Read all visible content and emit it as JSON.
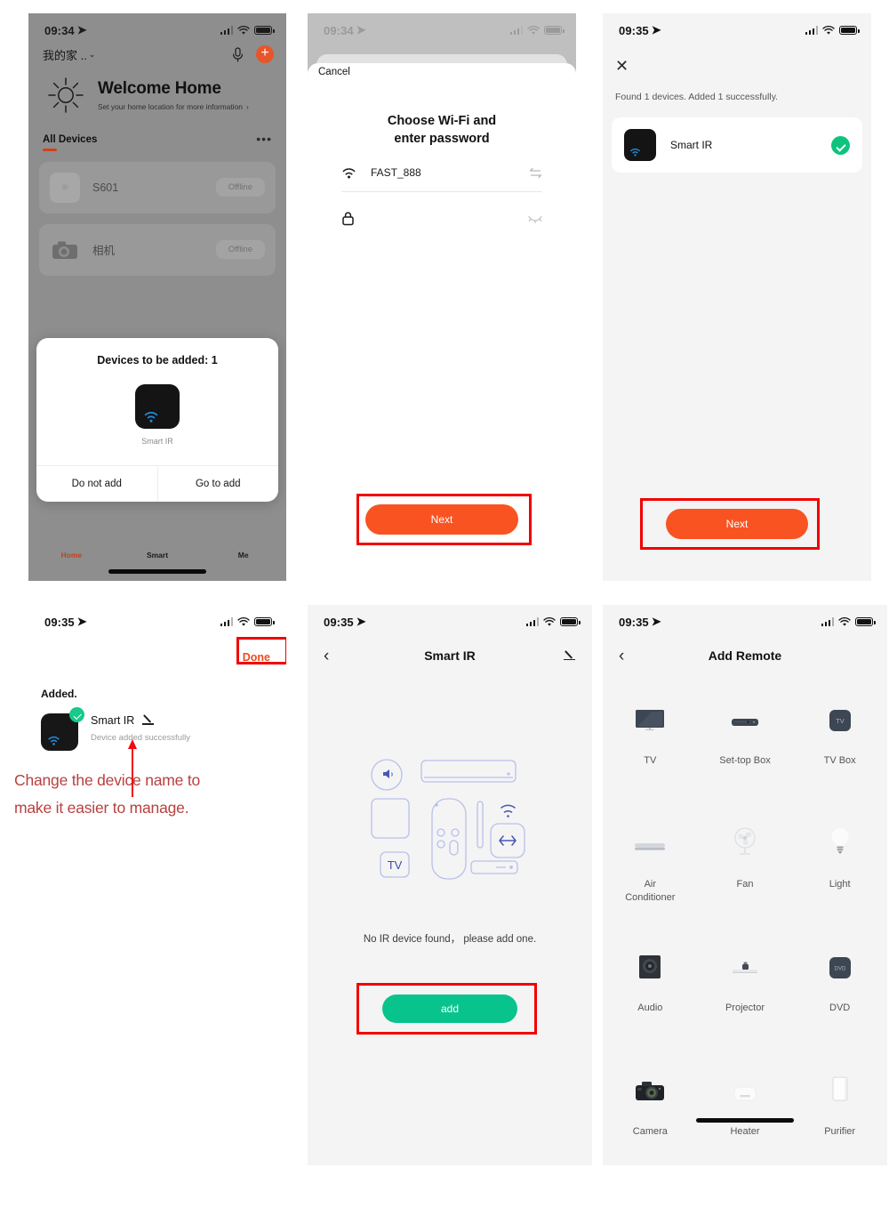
{
  "panel1": {
    "status": {
      "time": "09:34"
    },
    "home_name": "我的家 ..",
    "welcome_title": "Welcome Home",
    "welcome_sub": "Set your home location for more information",
    "section_title": "All Devices",
    "devices": [
      {
        "name": "S601",
        "state": "Offline"
      },
      {
        "name": "相机",
        "state": "Offline"
      }
    ],
    "modal": {
      "title": "Devices to be added: 1",
      "device_name": "Smart IR",
      "cancel_label": "Do not add",
      "confirm_label": "Go to add"
    },
    "tabs": [
      {
        "label": "Home",
        "active": true
      },
      {
        "label": "Smart",
        "active": false
      },
      {
        "label": "Me",
        "active": false
      }
    ]
  },
  "panel2": {
    "status": {
      "time": "09:34"
    },
    "cancel_label": "Cancel",
    "heading_line1": "Choose Wi-Fi and",
    "heading_line2": "enter password",
    "ssid": "FAST_888",
    "password": "",
    "password_placeholder": "",
    "next_label": "Next",
    "next_color": "#f95321"
  },
  "panel3": {
    "status": {
      "time": "09:35"
    },
    "found_text": "Found 1 devices. Added 1 successfully.",
    "device_name": "Smart IR",
    "next_label": "Next",
    "next_color": "#f95321"
  },
  "panel4": {
    "status": {
      "time": "09:35"
    },
    "done_label": "Done",
    "added_label": "Added.",
    "device_name": "Smart IR",
    "device_sub": "Device added successfully",
    "annotation_line1": "Change the device name to",
    "annotation_line2": "make it easier to manage.",
    "annotation_color": "#b8403f"
  },
  "panel5": {
    "status": {
      "time": "09:35"
    },
    "title": "Smart IR",
    "empty_text": "No IR device found，  please add one.",
    "add_label": "add",
    "add_color": "#08c48c",
    "illus_tv_label": "TV"
  },
  "panel6": {
    "status": {
      "time": "09:35"
    },
    "title": "Add Remote",
    "items": [
      {
        "label": "TV",
        "icon": "tv-icon"
      },
      {
        "label": "Set-top Box",
        "icon": "set-top-box-icon"
      },
      {
        "label": "TV Box",
        "icon": "tv-box-icon"
      },
      {
        "label": "Air\nConditioner",
        "icon": "air-conditioner-icon"
      },
      {
        "label": "Fan",
        "icon": "fan-icon"
      },
      {
        "label": "Light",
        "icon": "light-icon"
      },
      {
        "label": "Audio",
        "icon": "audio-icon"
      },
      {
        "label": "Projector",
        "icon": "projector-icon"
      },
      {
        "label": "DVD",
        "icon": "dvd-icon"
      },
      {
        "label": "Camera",
        "icon": "camera-icon"
      },
      {
        "label": "Heater",
        "icon": "heater-icon"
      },
      {
        "label": "Purifier",
        "icon": "purifier-icon"
      }
    ]
  }
}
